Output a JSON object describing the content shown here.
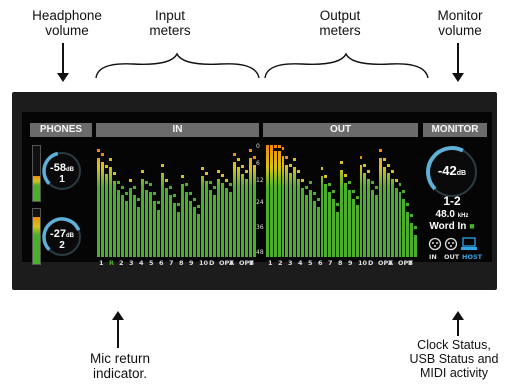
{
  "callouts": {
    "headphone": "Headphone\nvolume",
    "input": "Input\nmeters",
    "output": "Output\nmeters",
    "monitor": "Monitor\nvolume",
    "mic": "Mic return\nindicator.",
    "clock": "Clock Status,\nUSB Status and\nMIDI activity"
  },
  "headers": {
    "phones": "PHONES",
    "in": "IN",
    "out": "OUT",
    "monitor": "MONITOR"
  },
  "phones": [
    {
      "value": "-58",
      "unit": "dB",
      "channel": "1",
      "level": 0.45
    },
    {
      "value": "-27",
      "unit": "dB",
      "channel": "2",
      "level": 0.85
    }
  ],
  "scale": [
    "0",
    "6",
    "12",
    "24",
    "36",
    "48"
  ],
  "in_meters": {
    "labels": [
      "1",
      "R",
      "2",
      "3",
      "4",
      "5",
      "6",
      "7",
      "8",
      "9",
      "10",
      "D",
      "OPT",
      "A",
      "OPT",
      "B"
    ],
    "levels": [
      0.88,
      0.85,
      0.74,
      0.8,
      0.68,
      0.6,
      0.55,
      0.5,
      0.62,
      0.55,
      0.45,
      0.7,
      0.6,
      0.58,
      0.5,
      0.42,
      0.75,
      0.62,
      0.55,
      0.48,
      0.4,
      0.65,
      0.58,
      0.5,
      0.45,
      0.38,
      0.72,
      0.68,
      0.6,
      0.55,
      0.7,
      0.66,
      0.62,
      0.58,
      0.85,
      0.8,
      0.74,
      0.7,
      0.88,
      0.82
    ]
  },
  "out_meters": {
    "labels": [
      "1",
      "2",
      "3",
      "4",
      "5",
      "6",
      "7",
      "8",
      "9",
      "10",
      "D",
      "OPT",
      "A",
      "OPT",
      "B"
    ],
    "levels": [
      0.97,
      0.97,
      0.95,
      0.95,
      0.9,
      0.82,
      0.75,
      0.8,
      0.7,
      0.62,
      0.55,
      0.6,
      0.5,
      0.45,
      0.72,
      0.65,
      0.58,
      0.52,
      0.4,
      0.78,
      0.66,
      0.6,
      0.52,
      0.46,
      0.82,
      0.75,
      0.7,
      0.6,
      0.55,
      0.88,
      0.8,
      0.75,
      0.7,
      0.62,
      0.58,
      0.52,
      0.4,
      0.3,
      0.2
    ]
  },
  "monitor": {
    "value": "-42",
    "unit": "dB",
    "channels": "1-2",
    "sample_rate": "48.0",
    "sample_unit": "kHz",
    "clock": "Word In",
    "icons": {
      "in": "IN",
      "out": "OUT",
      "host": "HOST"
    }
  },
  "colors": {
    "green": "#4caf2c",
    "yellow": "#d8c21a",
    "orange": "#f08a10",
    "knob_arc": "#5fb0d8",
    "host": "#2fa4e7"
  }
}
